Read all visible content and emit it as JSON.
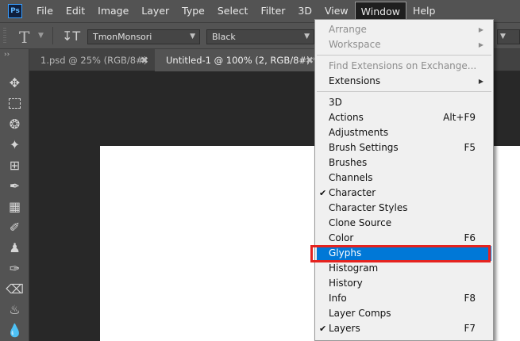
{
  "app": {
    "logo": "Ps"
  },
  "menubar": {
    "items": [
      "File",
      "Edit",
      "Image",
      "Layer",
      "Type",
      "Select",
      "Filter",
      "3D",
      "View",
      "Window",
      "Help"
    ],
    "active": "Window"
  },
  "options_bar": {
    "tool_icon": "T",
    "font_family": "TmonMonsori",
    "font_style": "Black"
  },
  "tabs": [
    {
      "label": "1.psd @ 25% (RGB/8#)",
      "active": false
    },
    {
      "label": "Untitled-1 @ 100% (2, RGB/8#) *",
      "active": true
    }
  ],
  "toolbar": {
    "tools": [
      "move-tool-icon",
      "marquee-tool-icon",
      "lasso-tool-icon",
      "magic-wand-icon",
      "crop-tool-icon",
      "eyedropper-icon",
      "healing-brush-icon",
      "brush-tool-icon",
      "clone-stamp-icon",
      "history-brush-icon",
      "eraser-icon",
      "paint-bucket-icon",
      "blur-tool-icon"
    ]
  },
  "window_menu": {
    "arrange": "Arrange",
    "workspace": "Workspace",
    "find_extensions": "Find Extensions on Exchange...",
    "extensions": "Extensions",
    "panels": [
      {
        "label": "3D",
        "shortcut": "",
        "checked": false
      },
      {
        "label": "Actions",
        "shortcut": "Alt+F9",
        "checked": false
      },
      {
        "label": "Adjustments",
        "shortcut": "",
        "checked": false
      },
      {
        "label": "Brush Settings",
        "shortcut": "F5",
        "checked": false
      },
      {
        "label": "Brushes",
        "shortcut": "",
        "checked": false
      },
      {
        "label": "Channels",
        "shortcut": "",
        "checked": false
      },
      {
        "label": "Character",
        "shortcut": "",
        "checked": true
      },
      {
        "label": "Character Styles",
        "shortcut": "",
        "checked": false
      },
      {
        "label": "Clone Source",
        "shortcut": "",
        "checked": false
      },
      {
        "label": "Color",
        "shortcut": "F6",
        "checked": false
      },
      {
        "label": "Glyphs",
        "shortcut": "",
        "checked": false,
        "highlighted": true
      },
      {
        "label": "Histogram",
        "shortcut": "",
        "checked": false
      },
      {
        "label": "History",
        "shortcut": "",
        "checked": false
      },
      {
        "label": "Info",
        "shortcut": "F8",
        "checked": false
      },
      {
        "label": "Layer Comps",
        "shortcut": "",
        "checked": false
      },
      {
        "label": "Layers",
        "shortcut": "F7",
        "checked": true
      }
    ]
  },
  "colors": {
    "highlight": "#0078d7",
    "annotation": "#e5231f",
    "panel_bg": "#535353",
    "canvas_bg": "#282828"
  }
}
